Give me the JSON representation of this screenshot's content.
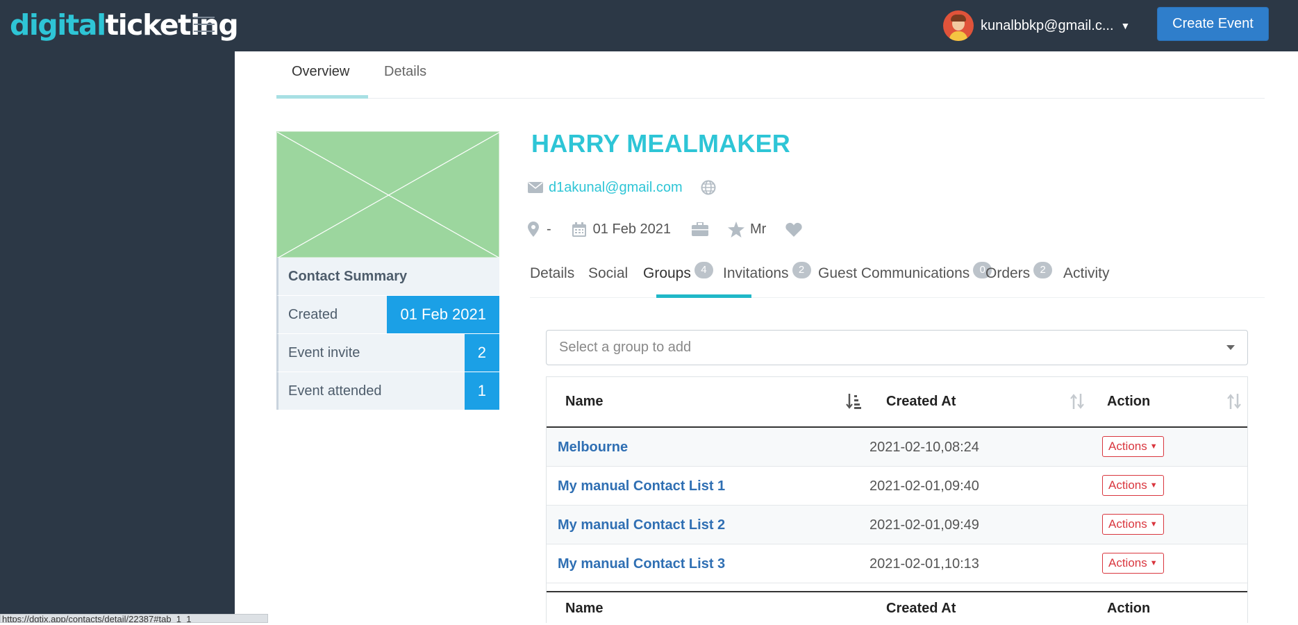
{
  "brand": {
    "part1": "digital",
    "part2": "ticketing"
  },
  "header": {
    "user_email": "kunalbbkp@gmail.c...",
    "create_event_label": "Create Event"
  },
  "top_tabs": [
    {
      "label": "Overview",
      "active": true
    },
    {
      "label": "Details",
      "active": false
    }
  ],
  "contact": {
    "name": "HARRY MEALMAKER",
    "email": "d1akunal@gmail.com",
    "location": "-",
    "date": "01 Feb 2021",
    "title": "Mr"
  },
  "summary": {
    "heading": "Contact Summary",
    "rows": [
      {
        "label": "Created",
        "value": "01 Feb 2021"
      },
      {
        "label": "Event invite",
        "value": "2"
      },
      {
        "label": "Event attended",
        "value": "1"
      }
    ]
  },
  "sub_tabs": [
    {
      "label": "Details"
    },
    {
      "label": "Social"
    },
    {
      "label": "Groups",
      "count": "4",
      "active": true
    },
    {
      "label": "Invitations",
      "count": "2"
    },
    {
      "label": "Guest Communications",
      "count": "0"
    },
    {
      "label": "Orders",
      "count": "2"
    },
    {
      "label": "Activity"
    }
  ],
  "group_select": {
    "placeholder": "Select a group to add"
  },
  "table": {
    "columns": [
      "Name",
      "Created At",
      "Action"
    ],
    "rows": [
      {
        "name": "Melbourne",
        "created_at": "2021-02-10,08:24",
        "action": "Actions"
      },
      {
        "name": "My manual Contact List 1",
        "created_at": "2021-02-01,09:40",
        "action": "Actions"
      },
      {
        "name": "My manual Contact List 2",
        "created_at": "2021-02-01,09:49",
        "action": "Actions"
      },
      {
        "name": "My manual Contact List 3",
        "created_at": "2021-02-01,10:13",
        "action": "Actions"
      }
    ]
  },
  "status_bar": {
    "url": "https://dgtix.app/contacts/detail/22387#tab_1_1"
  },
  "colors": {
    "accent": "#2ec5d6",
    "sidebar": "#2c3846",
    "primary_button": "#2f7ecb",
    "summary_value": "#1ba0e6",
    "action_red": "#d9363e"
  }
}
